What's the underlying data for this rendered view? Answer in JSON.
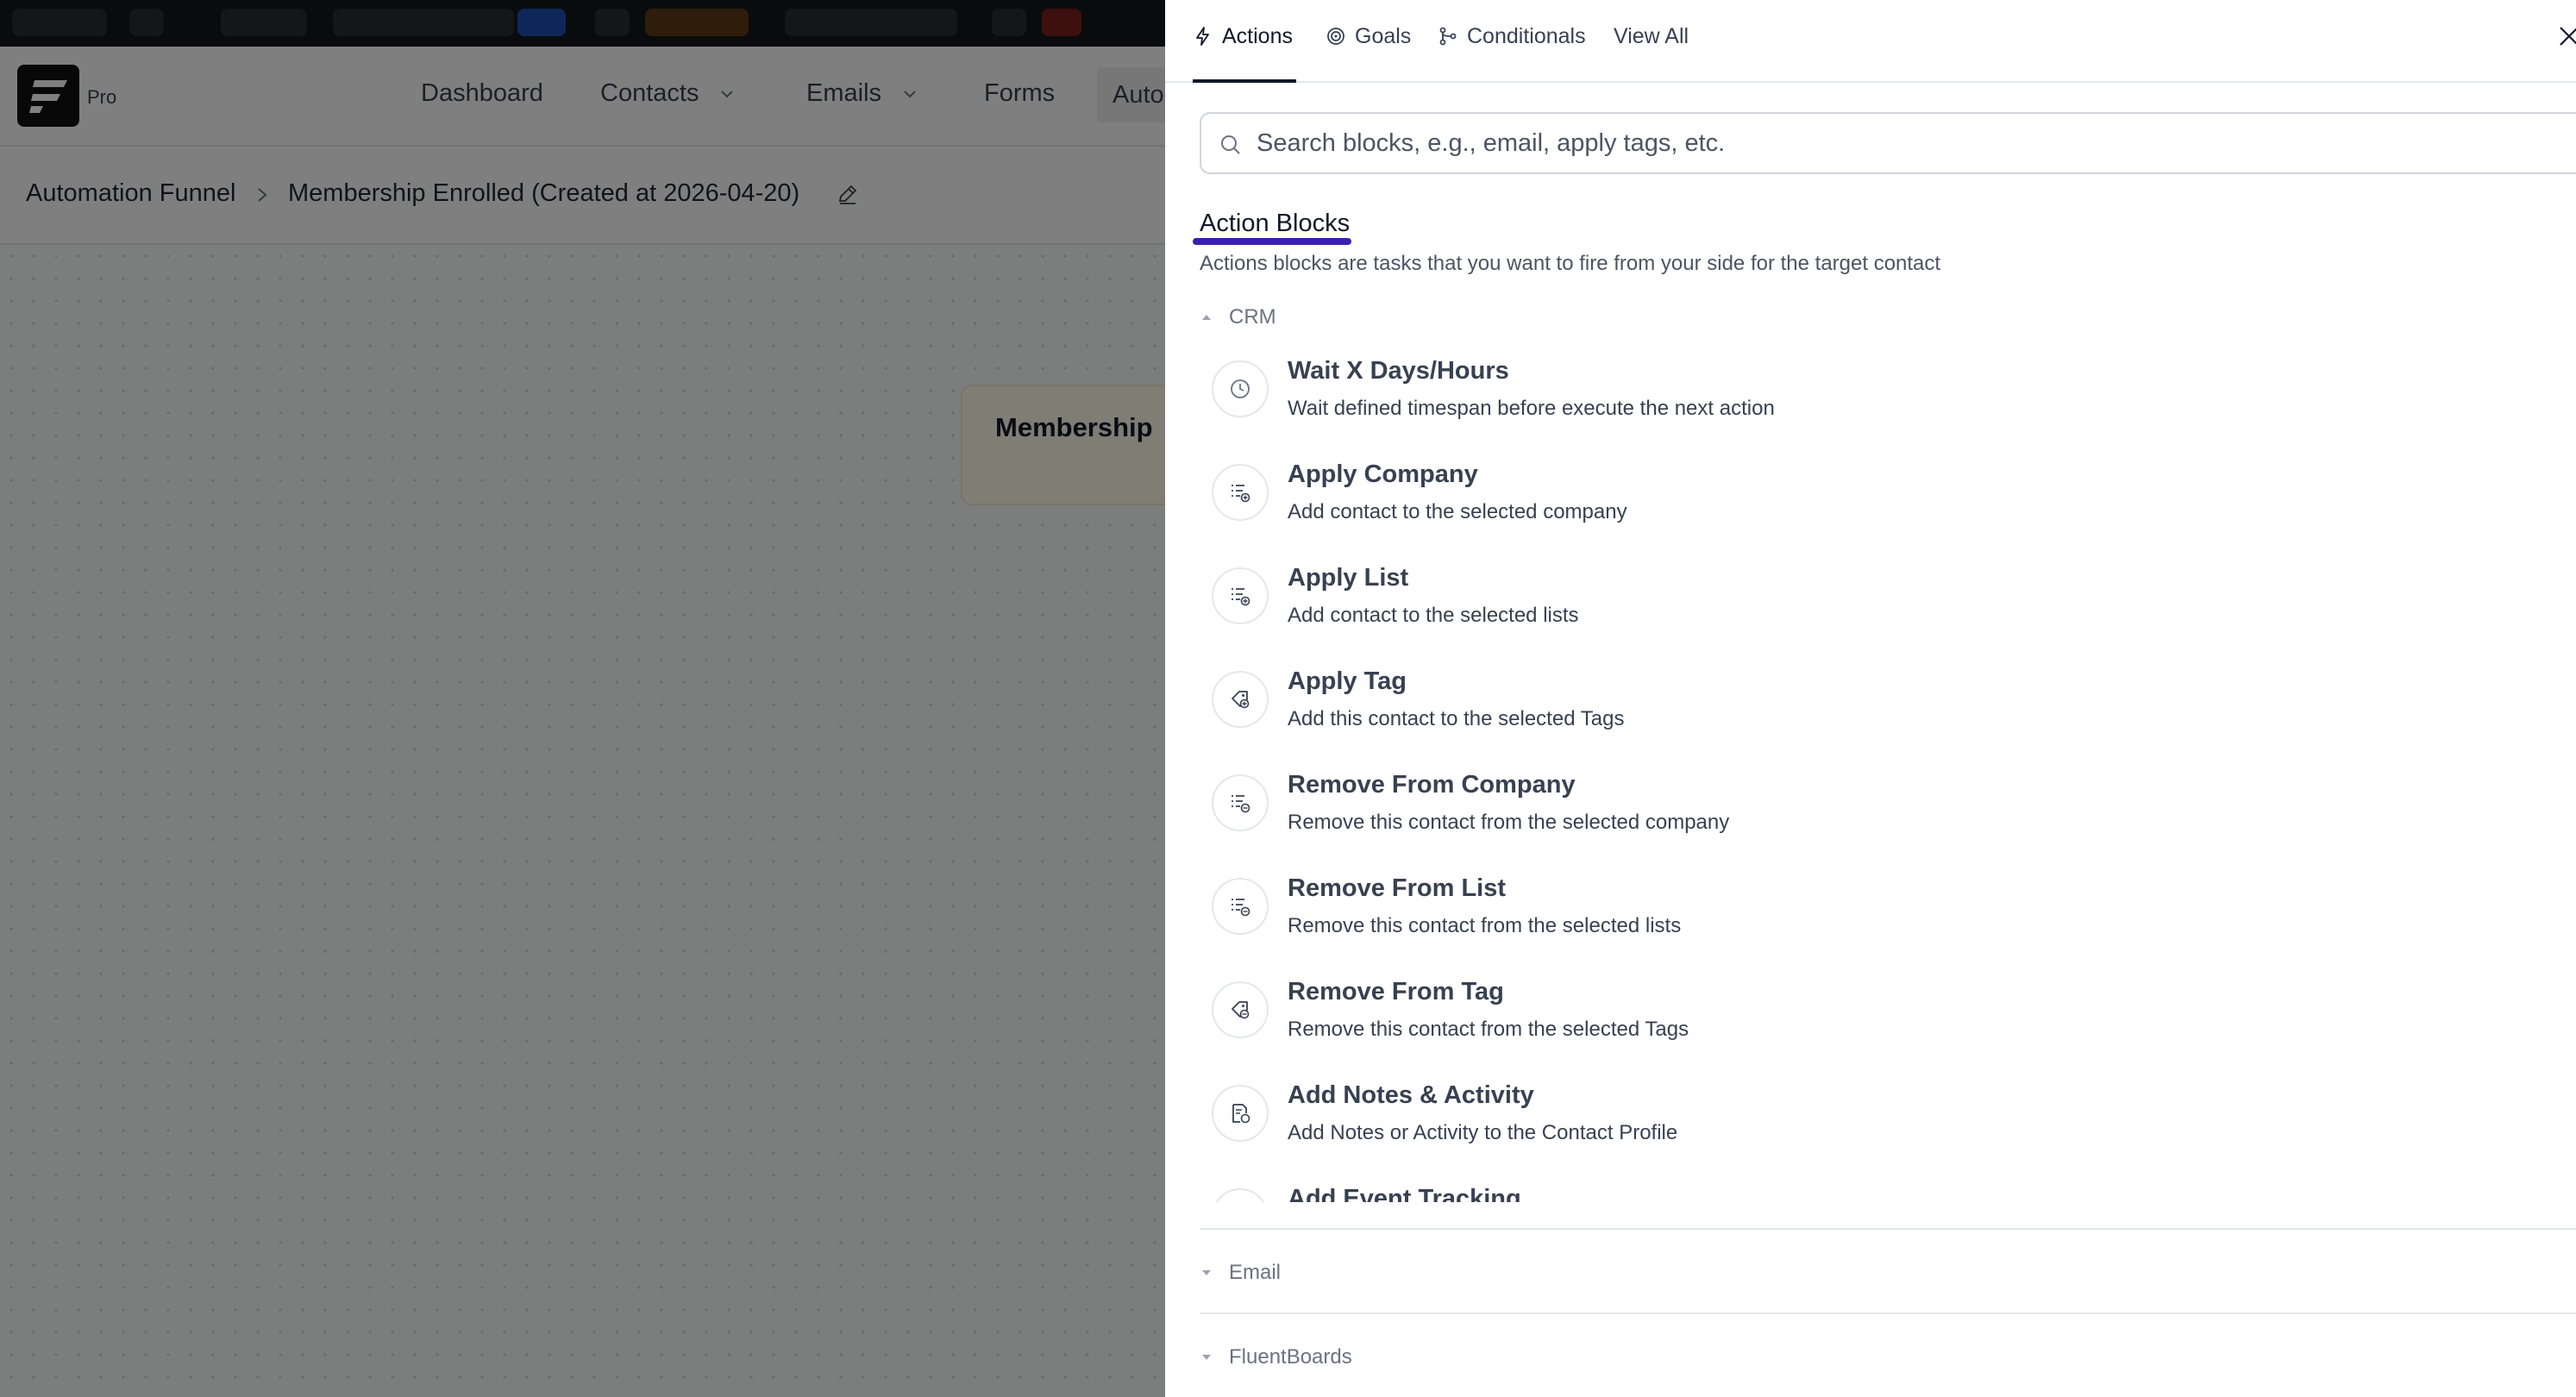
{
  "app": {
    "logo_badge": "Pro",
    "nav": [
      {
        "label": "Dashboard",
        "has_dropdown": false
      },
      {
        "label": "Contacts",
        "has_dropdown": true
      },
      {
        "label": "Emails",
        "has_dropdown": true
      },
      {
        "label": "Forms",
        "has_dropdown": false
      },
      {
        "label": "Auto",
        "has_dropdown": false,
        "active": true
      }
    ],
    "breadcrumb": {
      "root": "Automation Funnel",
      "current": "Membership Enrolled (Created at 2026-04-20)"
    },
    "canvas": {
      "node_title": "Membership"
    }
  },
  "drawer": {
    "tabs": [
      {
        "label": "Actions",
        "icon": "lightning-icon",
        "active": true
      },
      {
        "label": "Goals",
        "icon": "target-icon",
        "active": false
      },
      {
        "label": "Conditionals",
        "icon": "branch-icon",
        "active": false
      },
      {
        "label": "View All",
        "icon": "",
        "active": false
      }
    ],
    "search": {
      "placeholder": "Search blocks, e.g., email, apply tags, etc."
    },
    "section": {
      "title": "Action Blocks",
      "description": "Actions blocks are tasks that you want to fire from your side for the target contact"
    },
    "groups": [
      {
        "label": "CRM",
        "expanded": true
      },
      {
        "label": "Email",
        "expanded": false
      },
      {
        "label": "FluentBoards",
        "expanded": false
      }
    ],
    "crm_items": [
      {
        "title": "Wait X Days/Hours",
        "description": "Wait defined timespan before execute the next action",
        "icon": "clock-icon"
      },
      {
        "title": "Apply Company",
        "description": "Add contact to the selected company",
        "icon": "list-add-icon"
      },
      {
        "title": "Apply List",
        "description": "Add contact to the selected lists",
        "icon": "list-add-icon"
      },
      {
        "title": "Apply Tag",
        "description": "Add this contact to the selected Tags",
        "icon": "tag-add-icon"
      },
      {
        "title": "Remove From Company",
        "description": "Remove this contact from the selected company",
        "icon": "list-remove-icon"
      },
      {
        "title": "Remove From List",
        "description": "Remove this contact from the selected lists",
        "icon": "list-remove-icon"
      },
      {
        "title": "Remove From Tag",
        "description": "Remove this contact from the selected Tags",
        "icon": "tag-remove-icon"
      },
      {
        "title": "Add Notes & Activity",
        "description": "Add Notes or Activity to the Contact Profile",
        "icon": "note-icon"
      },
      {
        "title": "Add Event Tracking",
        "description": "",
        "icon": "event-icon"
      }
    ],
    "colors": {
      "accent_underline": "#3b1fb0",
      "overlay": "rgba(0,0,0,0.5)"
    }
  }
}
